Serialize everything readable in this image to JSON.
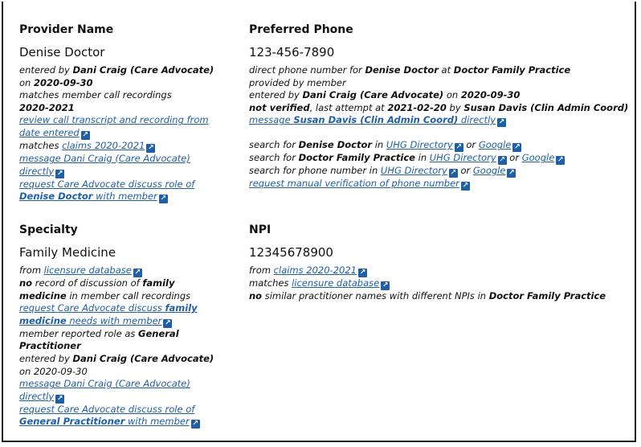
{
  "provider_name": {
    "heading": "Provider Name",
    "value": "Denise Doctor",
    "l1a": "entered by ",
    "l1b": "Dani Craig (Care Advocate)",
    "l2a": "on ",
    "l2b": "2020-09-30",
    "l3": "matches member call recordings",
    "l4": "2020-2021",
    "link1a": "review call transcript and recording from",
    "link1b": "date entered",
    "l5": "matches ",
    "link2": "claims 2020-2021",
    "link3a": "message Dani Craig (Care Advocate)",
    "link3b": "directly",
    "link4a": "request Care Advocate discuss role of",
    "link4b": "Denise Doctor",
    "link4c": " with member"
  },
  "preferred_phone": {
    "heading": "Preferred Phone",
    "value": "123-456-7890",
    "l1a": "direct phone number for ",
    "l1b": "Denise Doctor",
    "l1c": " at ",
    "l1d": "Doctor Family Practice",
    "l2": "provided by member",
    "l3a": "entered by ",
    "l3b": "Dani Craig (Care Advocate)",
    "l3c": " on ",
    "l3d": "2020-09-30",
    "l4a": "not verified",
    "l4b": ", last attempt at ",
    "l4c": "2021-02-20",
    "l4d": " by ",
    "l4e": "Susan Davis (Clin Admin Coord)",
    "link1a": "message ",
    "link1b": "Susan Davis (Clin Admin Coord)",
    "link1c": " directly",
    "s1a": "search for ",
    "s1b": "Denise Doctor",
    "s1c": " in ",
    "s1d": "UHG Directory",
    "s1e": " or ",
    "s1f": "Google",
    "s2a": "search for ",
    "s2b": "Doctor Family Practice",
    "s2c": " in ",
    "s2d": "UHG Directory",
    "s2e": " or ",
    "s2f": "Google",
    "s3a": "search for phone number in ",
    "s3b": "UHG Directory",
    "s3c": " or ",
    "s3d": "Google",
    "link2": "request manual verification of phone number"
  },
  "specialty": {
    "heading": "Specialty",
    "value": "Family Medicine",
    "l1a": "from ",
    "link1": "licensure database",
    "l2a": "no",
    "l2b": " record of discussion of ",
    "l2c": "family",
    "l3a": "medicine",
    "l3b": " in member call recordings",
    "link2a": "request Care Advocate discuss ",
    "link2b": "family",
    "link2c": "medicine",
    "link2d": " needs with member",
    "l4a": "member reported role as ",
    "l4b": "General",
    "l5": "Practitioner",
    "l6a": "entered by ",
    "l6b": "Dani Craig (Care Advocate)",
    "l7": "on 2020-09-30",
    "link3a": "message Dani Craig (Care Advocate)",
    "link3b": "directly",
    "link4a": "request Care Advocate discuss role of",
    "link4b": "General Practitioner",
    "link4c": " with member"
  },
  "npi": {
    "heading": "NPI",
    "value": "12345678900",
    "l1a": "from ",
    "link1": "claims 2020-2021",
    "l2a": "matches ",
    "link2": "licensure database",
    "l3a": "no",
    "l3b": " similar practitioner names with different NPIs in ",
    "l3c": "Doctor Family Practice"
  },
  "icons": {
    "external": "external-link-icon"
  }
}
